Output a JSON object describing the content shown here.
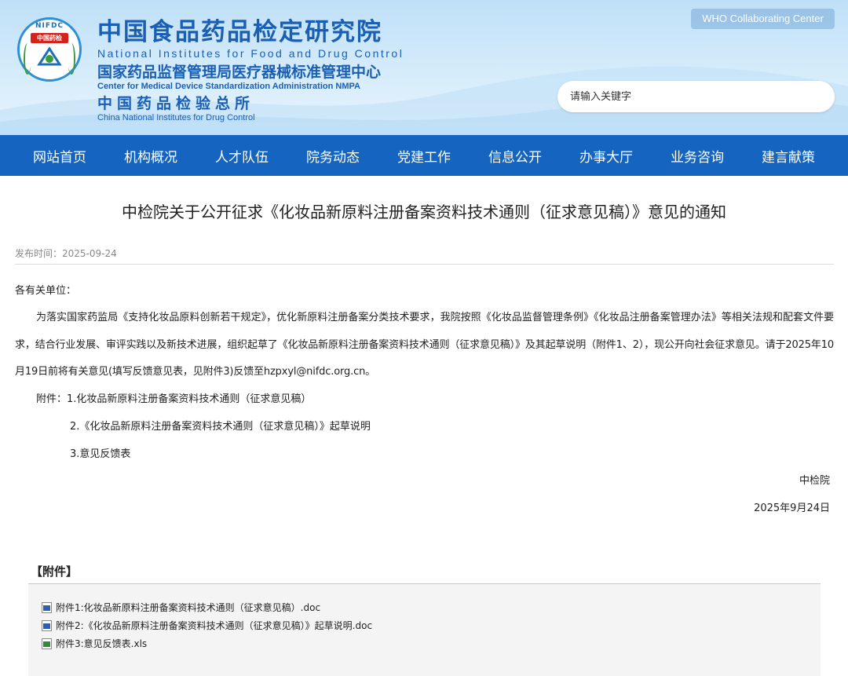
{
  "header": {
    "logo_ring_text": "NIFDC",
    "logo_badge_text": "中国药检",
    "title_cn": "中国食品药品检定研究院",
    "title_en": "National Institutes for Food and Drug Control",
    "subtitle_cn": "国家药品监督管理局医疗器械标准管理中心",
    "subtitle_en": "Center for Medical Device Standardization Administration NMPA",
    "sub2_cn": "中国药品检验总所",
    "sub2_en": "China National Institutes for Drug Control",
    "who_button": "WHO Collaborating Center",
    "search_placeholder": "请输入关键字"
  },
  "nav": {
    "items": [
      "网站首页",
      "机构概况",
      "人才队伍",
      "院务动态",
      "党建工作",
      "信息公开",
      "办事大厅",
      "业务咨询",
      "建言献策"
    ]
  },
  "article": {
    "title": "中检院关于公开征求《化妆品新原料注册备案资料技术通则（征求意见稿）》意见的通知",
    "publish_date": "发布时间：2025-09-24",
    "greeting": "各有关单位：",
    "main_paragraph": "为落实国家药监局《支持化妆品原料创新若干规定》，优化新原料注册备案分类技术要求，我院按照《化妆品监督管理条例》《化妆品注册备案管理办法》等相关法规和配套文件要求，结合行业发展、审评实践以及新技术进展，组织起草了《化妆品新原料注册备案资料技术通则（征求意见稿）》及其起草说明（附件1、2），现公开向社会征求意见。请于2025年10月19日前将有关意见(填写反馈意见表，见附件3)反馈至hzpxyl@nifdc.org.cn。",
    "attachment_line1": "附件：1.化妆品新原料注册备案资料技术通则（征求意见稿）",
    "attachment_line2": "2.《化妆品新原料注册备案资料技术通则（征求意见稿）》起草说明",
    "attachment_line3": "3.意见反馈表",
    "signature_org": "中检院",
    "signature_date": "2025年9月24日"
  },
  "attachments": {
    "heading": "【附件】",
    "files": [
      {
        "name": "附件1:化妆品新原料注册备案资料技术通则（征求意见稿）.doc",
        "icon": "word-doc-icon"
      },
      {
        "name": "附件2:《化妆品新原料注册备案资料技术通则（征求意见稿）》起草说明.doc",
        "icon": "word-doc-icon"
      },
      {
        "name": "附件3:意见反馈表.xls",
        "icon": "excel-xls-icon"
      }
    ]
  },
  "colors": {
    "nav_bg": "#1565c0",
    "brand_blue": "#1a5fb4",
    "header_bg": "#cfe8fa"
  }
}
